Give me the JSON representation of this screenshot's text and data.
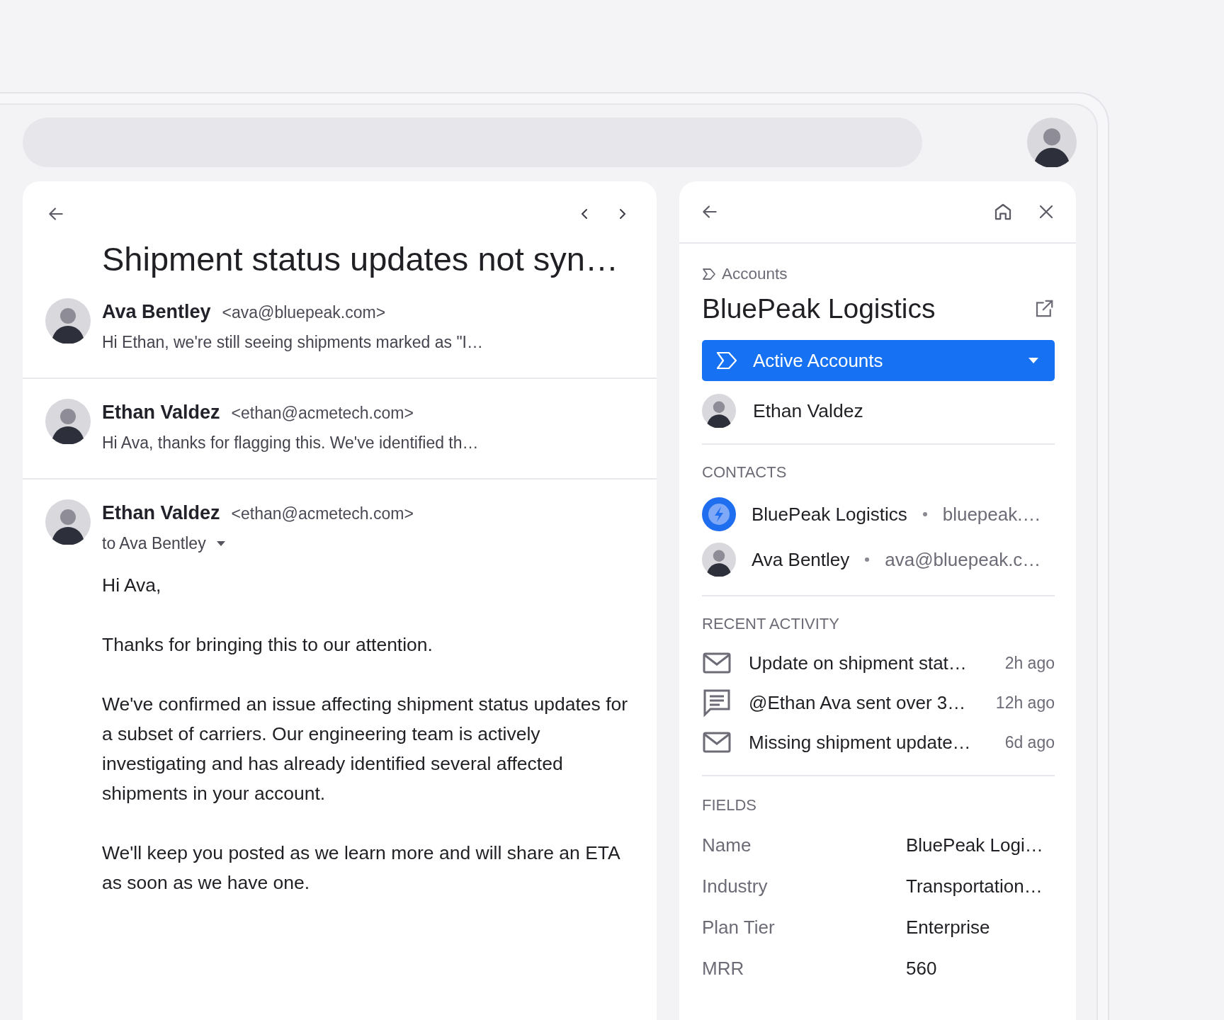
{
  "thread": {
    "title": "Shipment status updates not syn…",
    "messages": [
      {
        "kind": "collapsed",
        "sender": "Ava Bentley",
        "email": "<ava@bluepeak.com>",
        "preview": "Hi Ethan, we're still seeing shipments marked as \"I…"
      },
      {
        "kind": "collapsed",
        "sender": "Ethan Valdez",
        "email": "<ethan@acmetech.com>",
        "preview": "Hi Ava, thanks for flagging this. We've identified th…"
      },
      {
        "kind": "expanded",
        "sender": "Ethan Valdez",
        "email": "<ethan@acmetech.com>",
        "recipient": "to Ava Bentley",
        "body": [
          "Hi Ava,",
          "Thanks for bringing this to our attention.",
          "We've confirmed an issue affecting shipment status updates for a subset of carriers. Our engineering team is actively investigating and has already identified several affected shipments in your account.",
          "We'll keep you posted as we learn more and will share an ETA as soon as we have one."
        ]
      }
    ]
  },
  "side_panel": {
    "breadcrumb": "Accounts",
    "title": "BluePeak Logistics",
    "pipeline": {
      "label": "Active Accounts"
    },
    "owner": {
      "name": "Ethan Valdez"
    },
    "contacts": {
      "heading": "CONTACTS",
      "items": [
        {
          "kind": "company",
          "name": "BluePeak Logistics",
          "detail": "bluepeak.…"
        },
        {
          "kind": "person",
          "name": "Ava Bentley",
          "detail": "ava@bluepeak.c…"
        }
      ]
    },
    "recent_activity": {
      "heading": "RECENT ACTIVITY",
      "items": [
        {
          "kind": "email",
          "text": "Update on shipment stat…",
          "time": "2h ago"
        },
        {
          "kind": "comment",
          "text": "@Ethan Ava sent over 3…",
          "time": "12h ago"
        },
        {
          "kind": "email",
          "text": "Missing shipment update…",
          "time": "6d ago"
        }
      ]
    },
    "fields": {
      "heading": "FIELDS",
      "items": [
        {
          "label": "Name",
          "value": "BluePeak Logi…"
        },
        {
          "label": "Industry",
          "value": "Transportation…"
        },
        {
          "label": "Plan Tier",
          "value": "Enterprise"
        },
        {
          "label": "MRR",
          "value": "560"
        }
      ]
    }
  }
}
